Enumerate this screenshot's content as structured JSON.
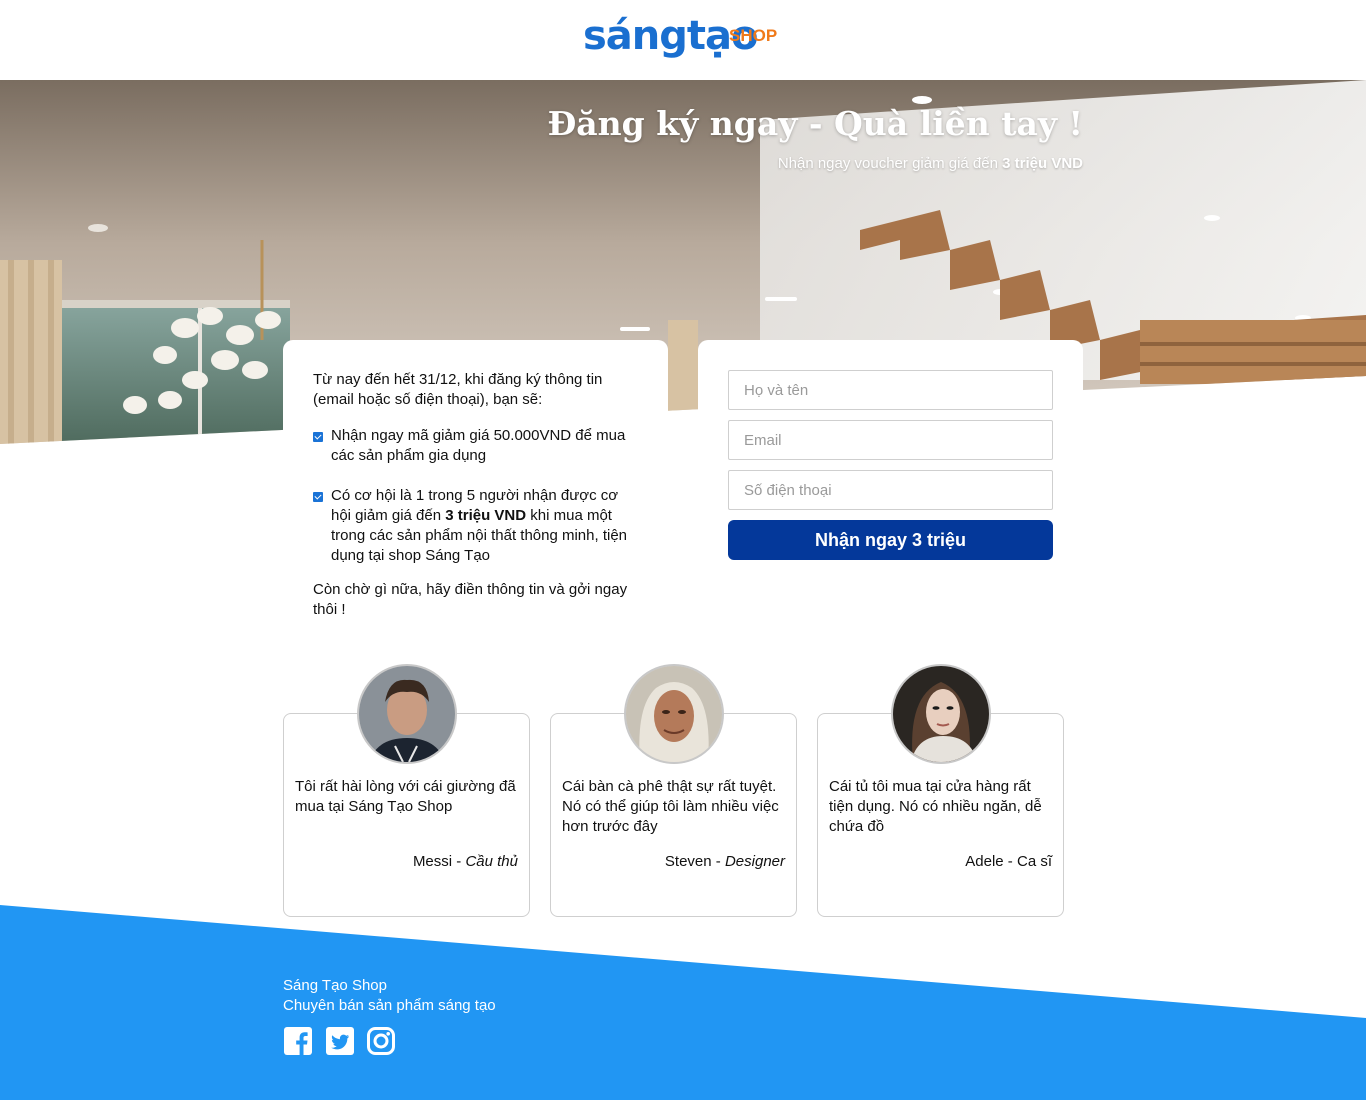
{
  "brand": {
    "logo_main": "sángtạo",
    "logo_shop": "SHOP",
    "primary_color": "#1a6fd0",
    "accent_color": "#f07a1a"
  },
  "hero": {
    "title": "Đăng ký ngay - Quà liền tay !",
    "subtitle_prefix": "Nhận ngay voucher giảm giá đến",
    "subtitle_highlight": "3 triệu VND"
  },
  "info": {
    "intro": "Từ nay đến hết 31/12, khi đăng ký thông tin (email hoặc số điện thoại), bạn sẽ:",
    "benefit_1": "Nhận ngay mã giảm giá 50.000VND để mua các sản phẩm gia dụng",
    "benefit_2_prefix": "Có cơ hội là 1 trong 5 người nhận được cơ hội giảm giá đến",
    "benefit_2_highlight": "3 triệu VND",
    "benefit_2_suffix": "khi mua một trong các sản phẩm nội thất thông minh, tiện dụng tại shop Sáng Tạo",
    "outro": "Còn chờ gì nữa, hãy điền thông tin và gởi ngay thôi !",
    "check_icon": "checkbox-checked-icon"
  },
  "form": {
    "name_placeholder": "Họ và tên",
    "email_placeholder": "Email",
    "phone_placeholder": "Số điện thoại",
    "submit_label": "Nhận ngay 3 triệu",
    "submit_color": "#04389a"
  },
  "testimonials": [
    {
      "quote": "Tôi rất hài lòng với cái giường đã mua tại Sáng Tạo Shop",
      "name": "Messi",
      "role": "Cầu thủ"
    },
    {
      "quote": "Cái bàn cà phê thật sự rất tuyệt. Nó có thể giúp tôi làm nhiều việc hơn trước đây",
      "name": "Steven",
      "role": "Designer"
    },
    {
      "quote": "Cái tủ tôi mua tại cửa hàng rất tiện dụng. Nó có nhiều ngăn, dễ chứa đồ",
      "name": "Adele",
      "role": "Ca sĩ"
    }
  ],
  "footer": {
    "name": "Sáng Tạo Shop",
    "tagline": "Chuyên bán sản phẩm sáng tạo",
    "background": "#2196f3",
    "social": [
      "facebook-icon",
      "twitter-icon",
      "instagram-icon"
    ]
  }
}
